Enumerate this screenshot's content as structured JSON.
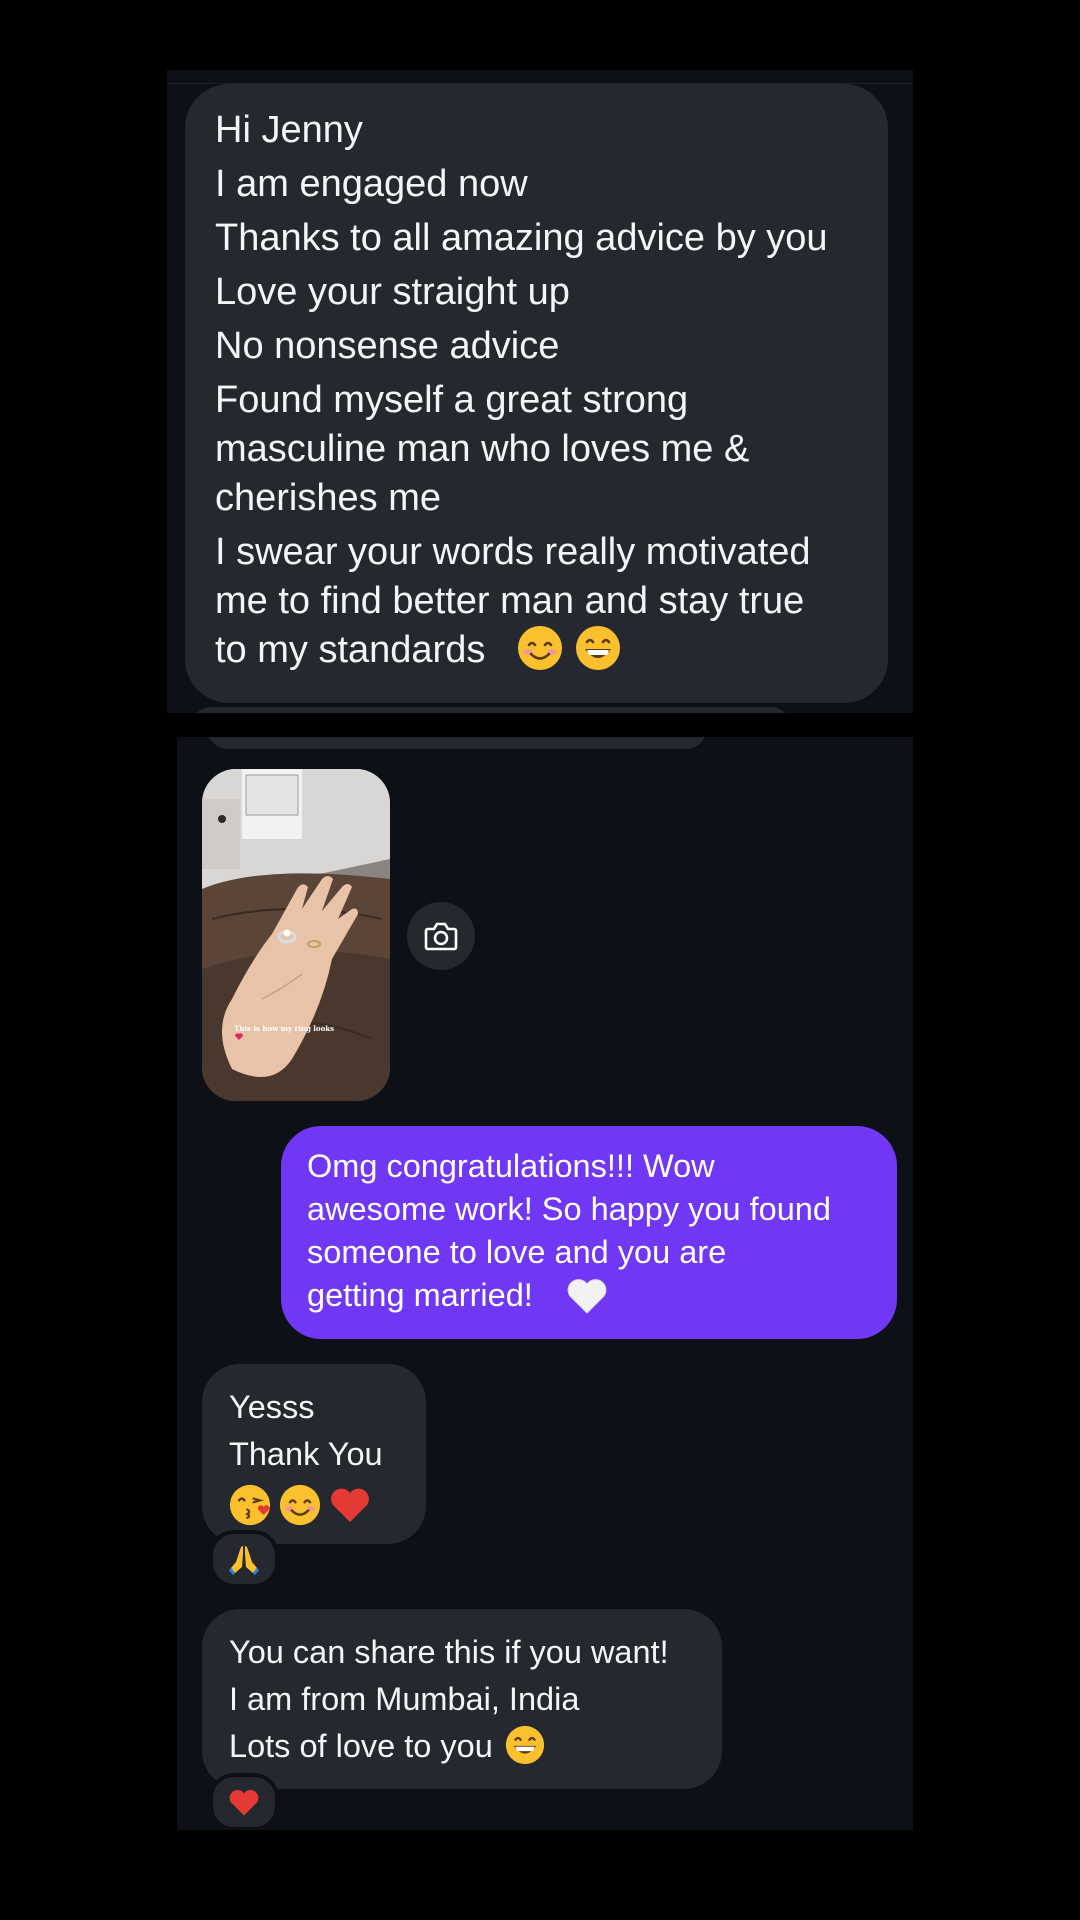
{
  "first_message": {
    "lines": [
      "Hi Jenny",
      "I am engaged now",
      "Thanks to all amazing advice by you",
      "Love your straight up",
      "No nonsense advice",
      "Found myself a great strong\nmasculine man who loves me &\ncherishes me",
      "I swear your words really motivated\nme to find better man and stay true\nto my standards"
    ],
    "emojis": [
      "smiling-face-icon",
      "grinning-face-icon"
    ]
  },
  "photo_message": {
    "caption": "This is how my ring looks",
    "caption_emoji": "heart-icon",
    "action_icon": "camera-icon"
  },
  "sent_message": {
    "text": "Omg congratulations!!! Wow\nawesome work! So happy you found\nsomeone to love and you are\ngetting married!",
    "emoji": "white-heart-icon",
    "color": "#7038f5"
  },
  "reply_message": {
    "lines": [
      "Yesss",
      "Thank You"
    ],
    "emojis": [
      "face-blowing-kiss-icon",
      "smiling-face-icon",
      "red-heart-icon"
    ],
    "reaction": "folded-hands-icon"
  },
  "share_message": {
    "lines": [
      "You can share this if you want!",
      "I am from Mumbai, India",
      "Lots of love to you"
    ],
    "emoji": "grinning-face-icon",
    "reaction": "red-heart-icon"
  },
  "colors": {
    "background": "#000000",
    "panel": "#0d1016",
    "received_bubble": "#25282e",
    "sent_bubble": "#7038f5"
  }
}
